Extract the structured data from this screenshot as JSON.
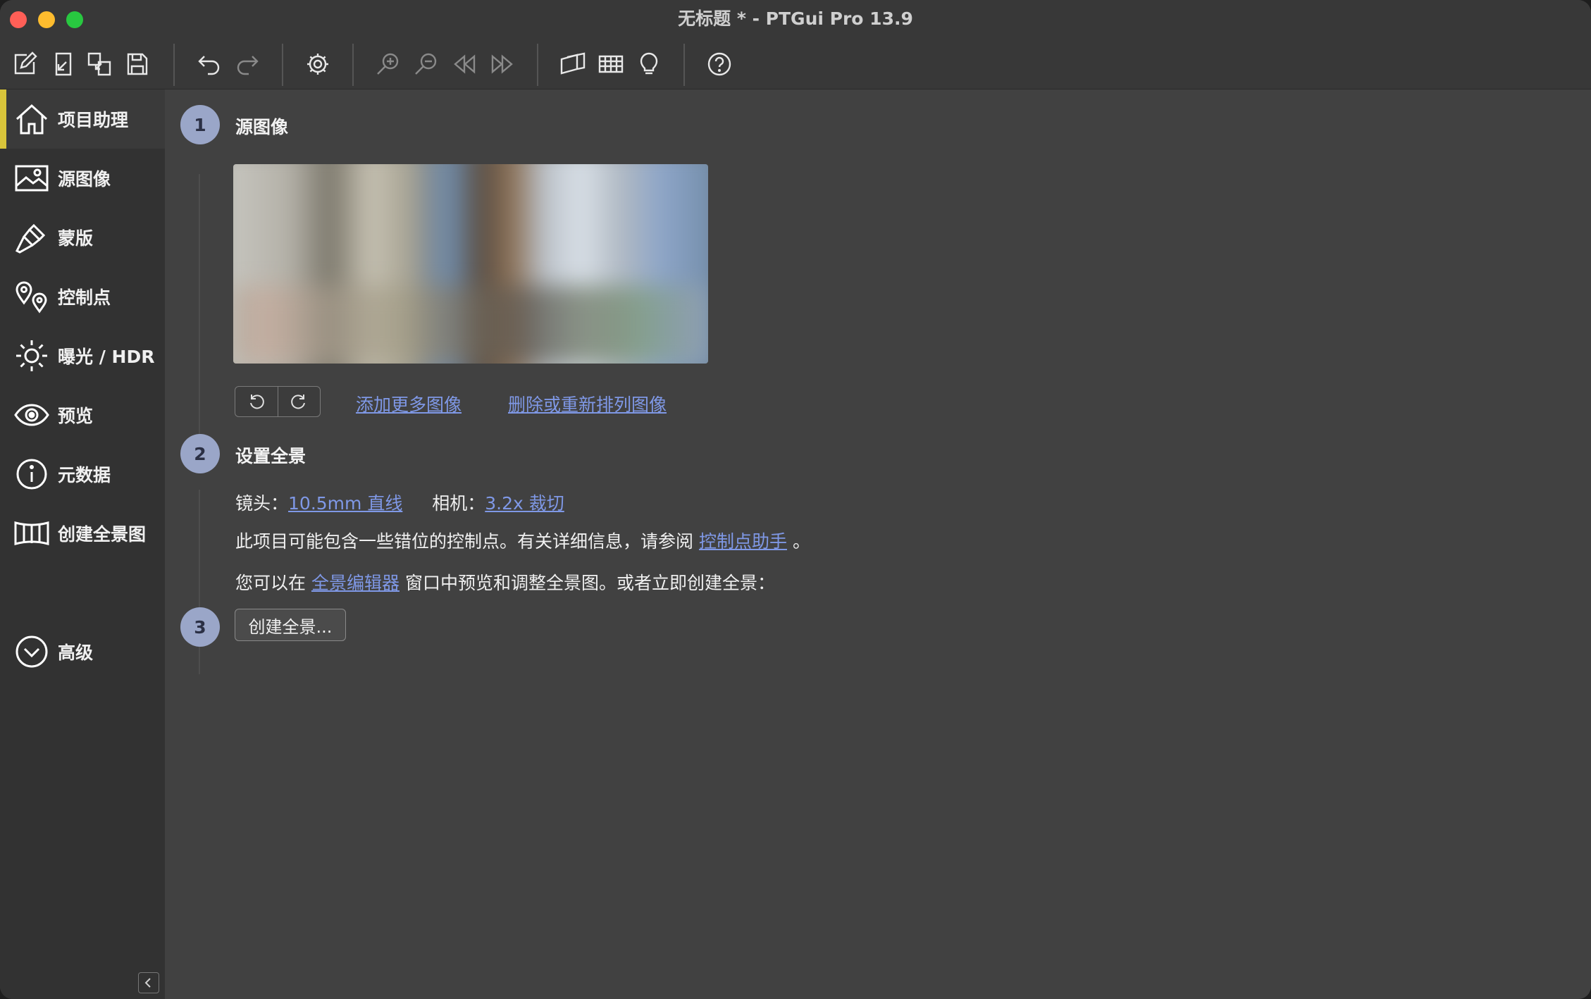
{
  "window": {
    "title": "无标题 * - PTGui Pro 13.9"
  },
  "toolbar": {
    "icons": [
      "new-project-icon",
      "open-project-icon",
      "open-template-icon",
      "save-icon",
      "undo-icon",
      "redo-icon",
      "settings-icon",
      "zoom-in-icon",
      "zoom-out-icon",
      "previous-icon",
      "next-icon",
      "panorama-editor-icon",
      "table-icon",
      "lightbulb-icon",
      "help-icon"
    ]
  },
  "sidebar": {
    "items": [
      {
        "label": "项目助理",
        "icon": "home-icon",
        "active": true
      },
      {
        "label": "源图像",
        "icon": "image-icon"
      },
      {
        "label": "蒙版",
        "icon": "brush-icon"
      },
      {
        "label": "控制点",
        "icon": "map-pin-icon"
      },
      {
        "label": "曝光 / HDR",
        "icon": "sun-icon"
      },
      {
        "label": "预览",
        "icon": "eye-icon"
      },
      {
        "label": "元数据",
        "icon": "info-icon"
      },
      {
        "label": "创建全景图",
        "icon": "panorama-icon"
      },
      {
        "label": "高级",
        "icon": "chevron-down-icon"
      }
    ]
  },
  "steps": {
    "step1": {
      "number": "1",
      "title": "源图像",
      "add_images_link": "添加更多图像",
      "remove_reorder_link": "删除或重新排列图像"
    },
    "step2": {
      "number": "2",
      "title": "设置全景",
      "lens_label": "镜头：",
      "lens_value": "10.5mm 直线",
      "camera_label": "相机：",
      "camera_value": "3.2x 裁切",
      "cp_text": "此项目可能包含一些错位的控制点。有关详细信息，请参阅",
      "cp_link": "控制点助手",
      "cp_end": "。",
      "preview_text_pre": "您可以在",
      "preview_link": "全景编辑器",
      "preview_text_post": "窗口中预览和调整全景图。或者立即创建全景："
    },
    "step3": {
      "number": "3",
      "create_button": "创建全景..."
    }
  }
}
